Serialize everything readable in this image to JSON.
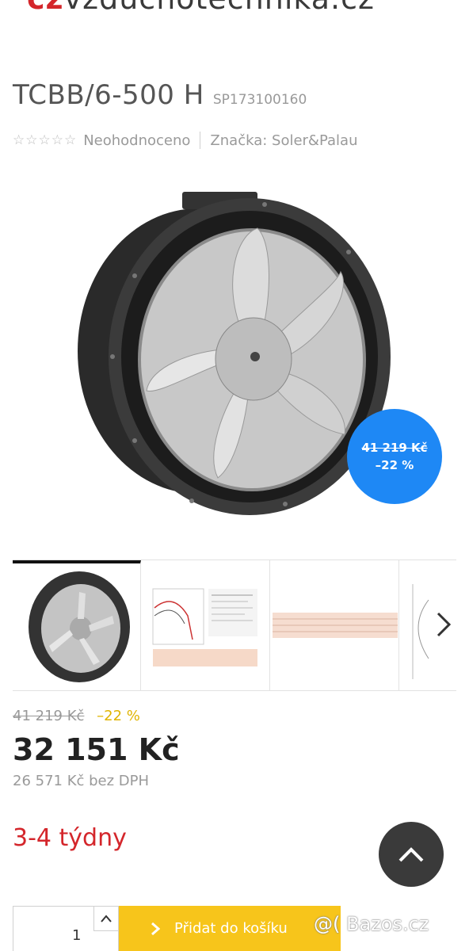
{
  "header": {
    "logo_prefix": "cz",
    "logo_text": "vzduchotechnika.cz"
  },
  "product": {
    "title": "TCBB/6-500 H",
    "sku": "SP173100160",
    "rating_text": "Neohodnoceno",
    "brand_text": "Značka: Soler&Palau"
  },
  "badge": {
    "old_price": "41 219 Kč",
    "discount": "–22 %"
  },
  "pricing": {
    "old_price": "41 219 Kč",
    "discount": "–22 %",
    "price": "32 151 Kč",
    "price_net": "26 571 Kč bez DPH"
  },
  "availability": "3-4 týdny",
  "cart": {
    "quantity": "1",
    "button_label": "Přidat do košíku"
  },
  "watermark": "@( Bazos.cz",
  "colors": {
    "accent_red": "#d4262b",
    "badge_blue": "#1e88f5",
    "cart_yellow": "#f7c51b",
    "discount_yellow": "#e0b400"
  }
}
